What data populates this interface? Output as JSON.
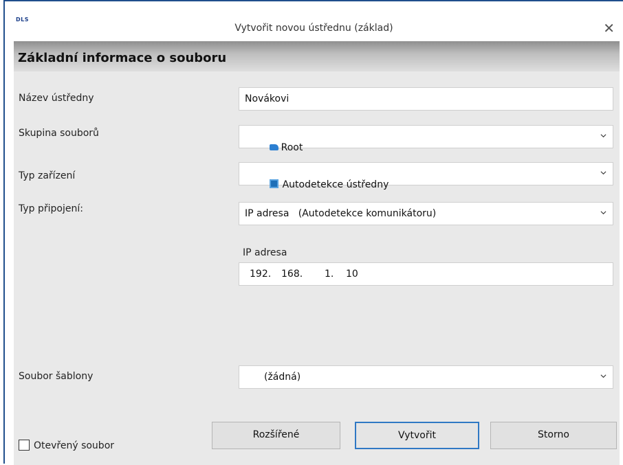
{
  "window": {
    "logo_text": "DLS",
    "title": "Vytvořit novou ústřednu (základ)",
    "close_glyph": "✕"
  },
  "section": {
    "header": "Základní informace o souboru"
  },
  "form": {
    "name_label": "Název ústředny",
    "name_value": "Novákovi",
    "group_label": "Skupina souborů",
    "group_value": "Root",
    "device_label": "Typ zařízení",
    "device_value": "Autodetekce ústředny",
    "connection_label": "Typ připojení:",
    "connection_value": "IP adresa   (Autodetekce komunikátoru)",
    "ip_label": "IP adresa",
    "ip_octets": [
      "192.",
      "168.",
      "1.",
      "10"
    ],
    "template_label": "Soubor šablony",
    "template_value": "(žádná)"
  },
  "footer": {
    "open_file_label": "Otevřený soubor",
    "open_file_checked": false,
    "advanced_button": "Rozšířené",
    "create_button": "Vytvořit",
    "cancel_button": "Storno"
  },
  "icons": {
    "close": "close-icon",
    "chevron": "chevron-down-icon",
    "folder": "folder-icon",
    "device": "device-icon"
  },
  "colors": {
    "window_border": "#1f4e8c",
    "content_background": "#e9e9e9",
    "button_focus_border": "#2f78c4"
  }
}
